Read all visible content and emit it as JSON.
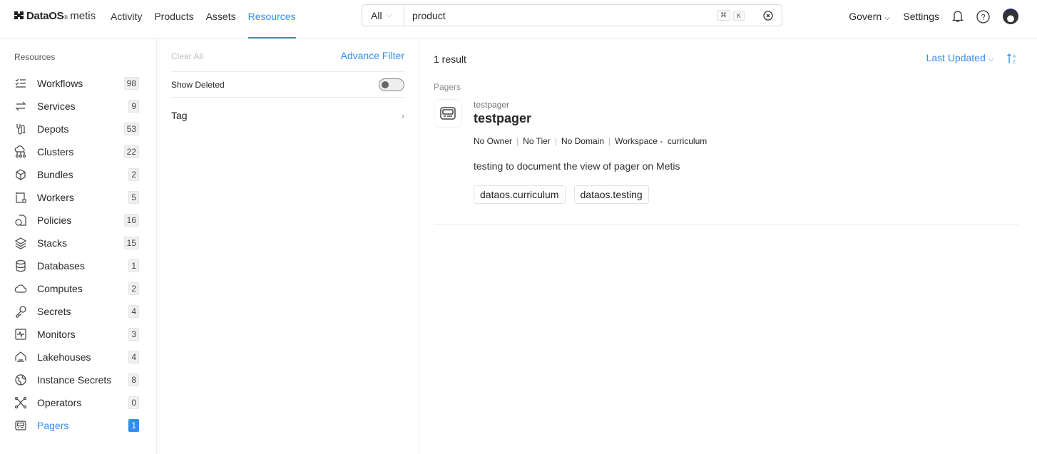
{
  "header": {
    "brand": "DataOS",
    "reg": "®",
    "product": "metis",
    "nav": [
      {
        "label": "Activity"
      },
      {
        "label": "Products"
      },
      {
        "label": "Assets"
      },
      {
        "label": "Resources",
        "active": true
      }
    ],
    "search": {
      "scope": "All",
      "value": "product",
      "shortcut_cmd": "⌘",
      "shortcut_key": "K"
    },
    "govern": "Govern",
    "settings": "Settings"
  },
  "sidebar": {
    "title": "Resources",
    "items": [
      {
        "label": "Workflows",
        "count": "98",
        "icon": "checklist-icon"
      },
      {
        "label": "Services",
        "count": "9",
        "icon": "arrows-exchange-icon"
      },
      {
        "label": "Depots",
        "count": "53",
        "icon": "plug-icon"
      },
      {
        "label": "Clusters",
        "count": "22",
        "icon": "cloud-network-icon"
      },
      {
        "label": "Bundles",
        "count": "2",
        "icon": "cube-icon"
      },
      {
        "label": "Workers",
        "count": "5",
        "icon": "frame-icon"
      },
      {
        "label": "Policies",
        "count": "16",
        "icon": "document-shape-icon"
      },
      {
        "label": "Stacks",
        "count": "15",
        "icon": "layers-icon"
      },
      {
        "label": "Databases",
        "count": "1",
        "icon": "database-icon"
      },
      {
        "label": "Computes",
        "count": "2",
        "icon": "cloud-icon"
      },
      {
        "label": "Secrets",
        "count": "4",
        "icon": "key-icon"
      },
      {
        "label": "Monitors",
        "count": "3",
        "icon": "pulse-icon"
      },
      {
        "label": "Lakehouses",
        "count": "4",
        "icon": "lakehouse-icon"
      },
      {
        "label": "Instance Secrets",
        "count": "8",
        "icon": "globe-icon"
      },
      {
        "label": "Operators",
        "count": "0",
        "icon": "operator-icon"
      },
      {
        "label": "Pagers",
        "count": "1",
        "icon": "pager-icon",
        "active": true
      }
    ]
  },
  "filter": {
    "clear_all": "Clear All",
    "advance_filter": "Advance Filter",
    "show_deleted": "Show Deleted",
    "show_deleted_on": false,
    "tag": "Tag"
  },
  "main": {
    "result_count": "1 result",
    "sort": "Last Updated",
    "group": "Pagers",
    "result": {
      "subtitle": "testpager",
      "name": "testpager",
      "meta": [
        "No Owner",
        "No Tier",
        "No Domain",
        "Workspace -  curriculum"
      ],
      "description": "testing to document the view of pager on Metis",
      "tags": [
        "dataos.curriculum",
        "dataos.testing"
      ]
    }
  },
  "colors": {
    "accent": "#2f8ef4"
  }
}
